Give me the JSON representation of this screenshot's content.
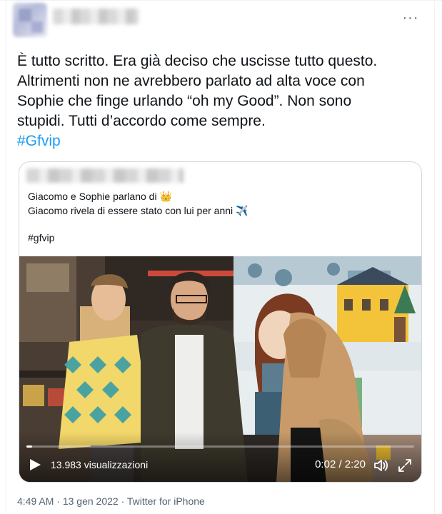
{
  "tweet": {
    "lines": [
      "È tutto scritto. Era già deciso che uscisse tutto questo.",
      "Altrimenti non ne avrebbero parlato ad alta voce con",
      "Sophie che finge urlando “oh my Good”. Non sono",
      "stupidi. Tutti d’accordo come sempre."
    ],
    "hashtag": "#Gfvip",
    "more_label": "···"
  },
  "quoted": {
    "line1": "Giacomo e Sophie parlano di 👑",
    "line2": "Giacomo rivela di essere stato con lui per anni ✈️",
    "hashtag": "#gfvip",
    "video": {
      "views": "13.983 visualizzazioni",
      "time": "0:02 / 2:20",
      "progress": 0.015
    }
  },
  "meta": {
    "time": "4:49 AM",
    "sep1": "·",
    "date": "13 gen 2022",
    "sep2": "·",
    "source": "Twitter for iPhone"
  },
  "colors": {
    "link": "#1d9bf0",
    "text": "#0f1419",
    "secondary": "#536471",
    "border": "#cfd9de"
  }
}
